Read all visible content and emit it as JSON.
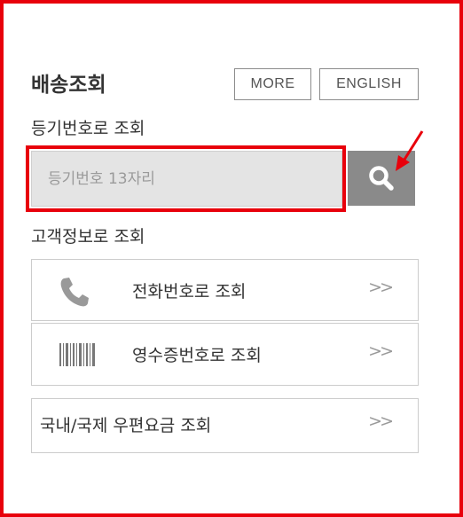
{
  "header": {
    "title": "배송조회",
    "more_label": "MORE",
    "english_label": "ENGLISH"
  },
  "registered": {
    "section_label": "등기번호로 조회",
    "placeholder": "등기번호 13자리",
    "search_icon": "search-icon"
  },
  "customer": {
    "section_label": "고객정보로 조회",
    "items": [
      {
        "label": "전화번호로 조회",
        "icon": "phone-icon",
        "chevron": ">>"
      },
      {
        "label": "영수증번호로 조회",
        "icon": "barcode-icon",
        "chevron": ">>"
      }
    ]
  },
  "postage": {
    "label": "국내/국제 우편요금 조회",
    "chevron": ">>"
  },
  "colors": {
    "highlight": "#e8000b",
    "search_button": "#8a8a8a",
    "input_bg": "#e4e4e4",
    "border": "#cccccc"
  }
}
